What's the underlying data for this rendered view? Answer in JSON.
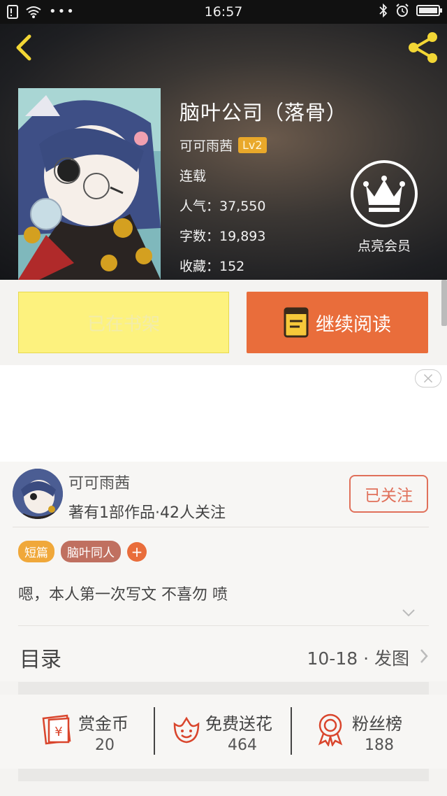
{
  "status_bar": {
    "time": "16:57"
  },
  "book": {
    "title": "脑叶公司（落骨）",
    "author": "可可雨茜",
    "level": "Lv2",
    "status": "连载",
    "popularity": "人气：37,550",
    "word_count": "字数：19,893",
    "favorites": "收藏：152"
  },
  "vip": {
    "label": "点亮会员"
  },
  "actions": {
    "shelf_label": "已在书架",
    "read_label": "继续阅读"
  },
  "author_card": {
    "name": "可可雨茜",
    "summary": "著有1部作品·42人关注",
    "follow_label": "已关注"
  },
  "tags": [
    {
      "label": "短篇",
      "color": "#f0a83a"
    },
    {
      "label": "脑叶同人",
      "color": "#c07060"
    }
  ],
  "tag_add": "+",
  "description": "嗯，本人第一次写文 不喜勿 喷",
  "toc": {
    "label": "目录",
    "latest": "10-18 · 发图"
  },
  "stats": [
    {
      "title": "赏金币",
      "value": "20",
      "icon": "red-envelope-icon"
    },
    {
      "title": "免费送花",
      "value": "464",
      "icon": "flower-icon"
    },
    {
      "title": "粉丝榜",
      "value": "188",
      "icon": "medal-icon"
    }
  ],
  "colors": {
    "accent": "#e96d3b",
    "shelf": "#fdf27e",
    "follow": "#e0705a"
  }
}
